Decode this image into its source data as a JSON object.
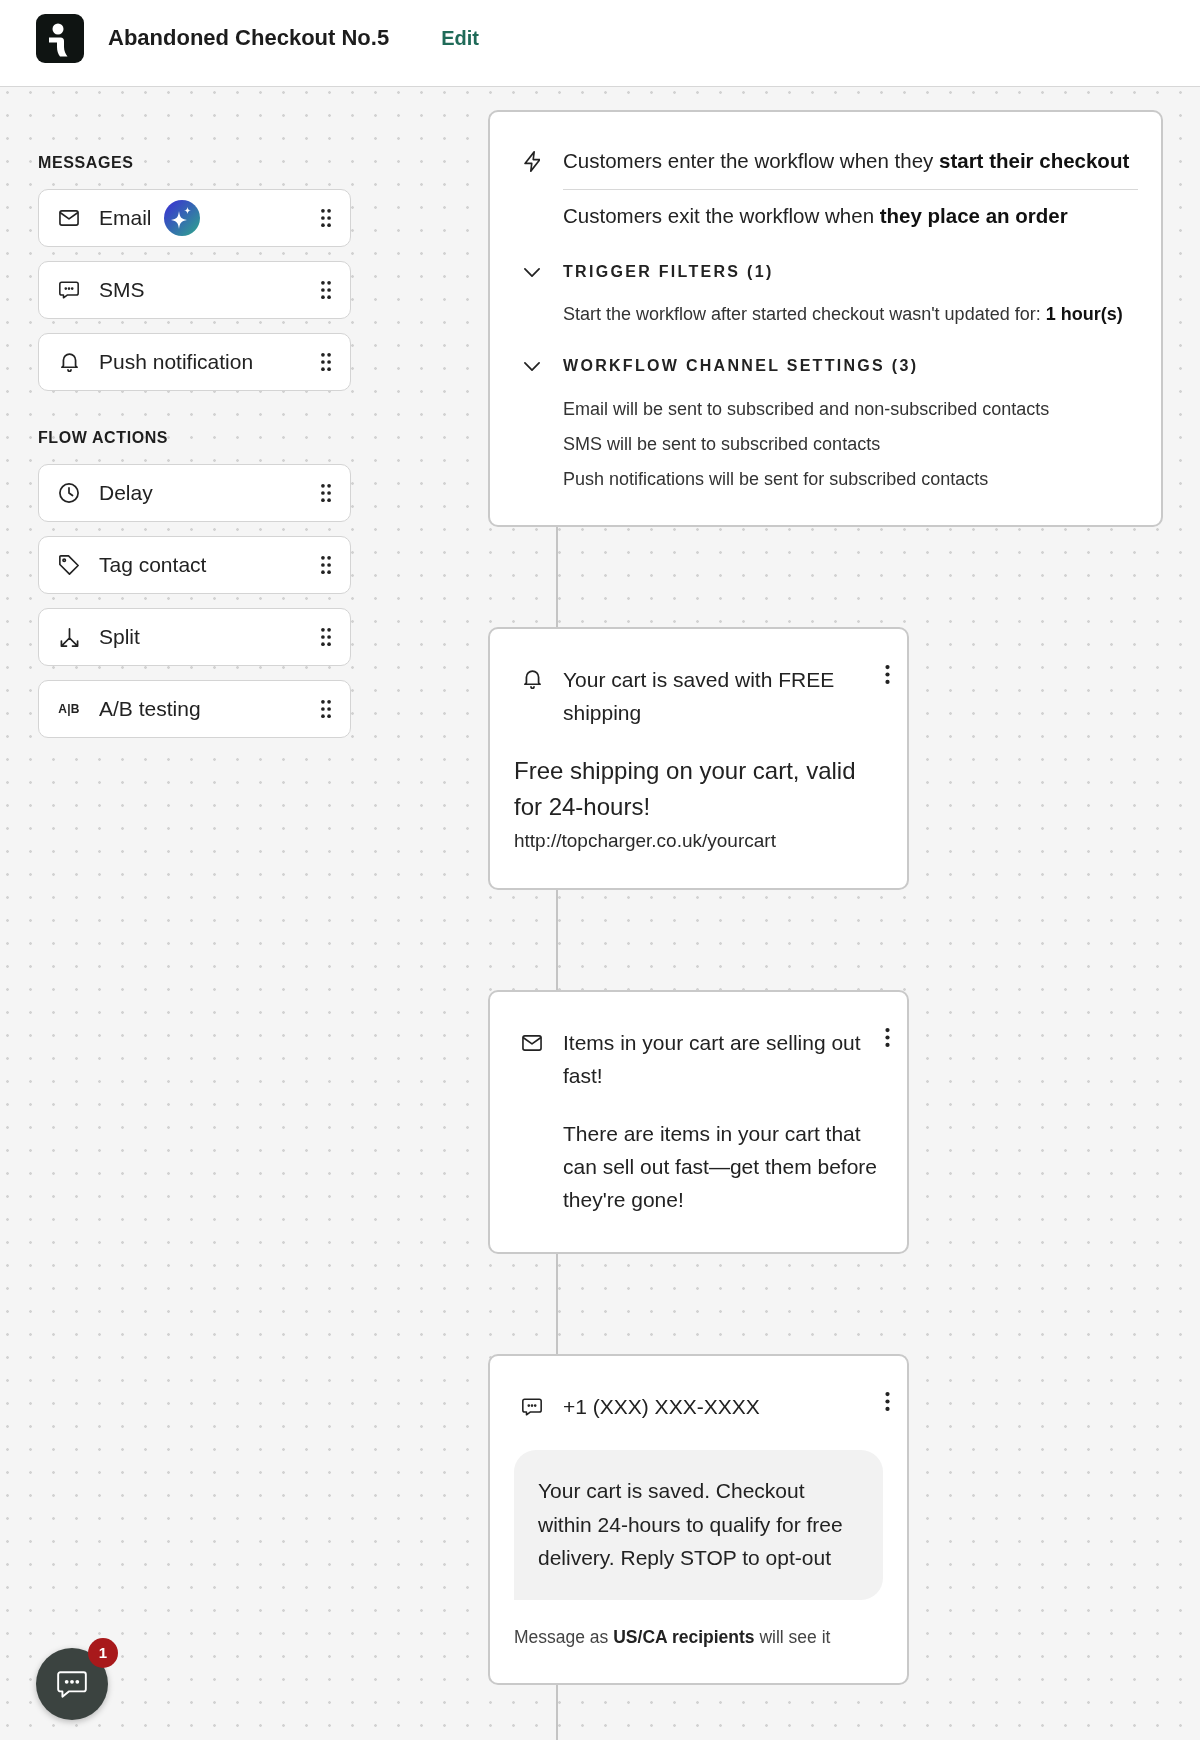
{
  "header": {
    "title": "Abandoned Checkout No.5",
    "edit_link": "Edit"
  },
  "sidebar": {
    "sections": [
      {
        "heading": "MESSAGES",
        "items": [
          {
            "kind": "email",
            "label": "Email",
            "ai": true
          },
          {
            "kind": "sms",
            "label": "SMS",
            "ai": false
          },
          {
            "kind": "push",
            "label": "Push notification",
            "ai": false
          }
        ]
      },
      {
        "heading": "FLOW ACTIONS",
        "items": [
          {
            "kind": "delay",
            "label": "Delay",
            "ai": false
          },
          {
            "kind": "tag",
            "label": "Tag contact",
            "ai": false
          },
          {
            "kind": "split",
            "label": "Split",
            "ai": false
          },
          {
            "kind": "ab",
            "label": "A/B testing",
            "icon_text": "A|B",
            "ai": false
          }
        ]
      }
    ]
  },
  "trigger": {
    "entry": "Customers enter the workflow when they **start their checkout**",
    "exit": "Customers exit the workflow when **they place an order**",
    "sections": [
      {
        "heading": "TRIGGER FILTERS (1)",
        "expanded": true,
        "lines": [
          "Start the workflow after started checkout wasn't updated for: **1 hour(s)**"
        ]
      },
      {
        "heading": "WORKFLOW CHANNEL SETTINGS (3)",
        "expanded": true,
        "lines": [
          "Email will be sent to subscribed and non-subscribed contacts",
          "SMS will be sent to subscribed contacts",
          "Push notifications will be sent for subscribed contacts"
        ]
      }
    ]
  },
  "steps": [
    {
      "kind": "push",
      "title": "Your cart is saved with FREE shipping",
      "body": "Free shipping on your cart, valid for 24-hours!",
      "link": "http://topcharger.co.uk/yourcart"
    },
    {
      "kind": "email",
      "title": "Items in your cart are selling out fast!",
      "body": "There are items in your cart that can sell out fast—get them before they're gone!"
    },
    {
      "kind": "sms",
      "title": "+1 (XXX) XXX-XXXX",
      "body": "Your cart is saved. Checkout within 24-hours to qualify for free delivery. Reply STOP to opt-out",
      "note": "Message as **US/CA recipients** will see it"
    }
  ],
  "chat": {
    "unread": "1"
  }
}
